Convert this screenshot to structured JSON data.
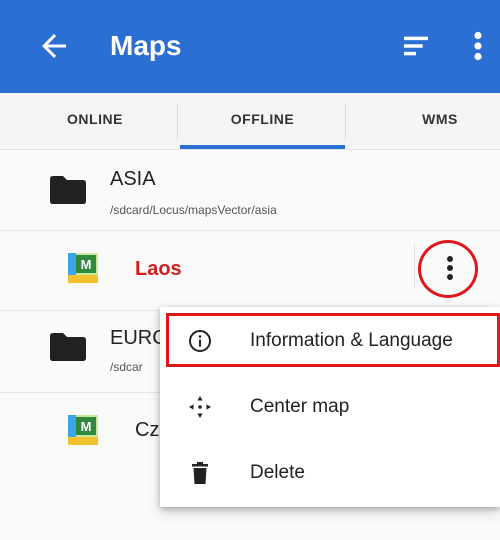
{
  "appbar": {
    "title": "Maps"
  },
  "tabs": [
    "ONLINE",
    "OFFLINE",
    "WMS"
  ],
  "list": {
    "folder_asia": {
      "name": "ASIA",
      "path": "/sdcard/Locus/mapsVector/asia"
    },
    "map_laos": {
      "name": "Laos"
    },
    "folder_europe": {
      "name": "EURC",
      "path": "/sdcar"
    },
    "map_czech": {
      "name": "Cz"
    }
  },
  "menu": {
    "items": [
      "Information & Language",
      "Center map",
      "Delete"
    ]
  },
  "colors": {
    "appbar": "#2b6fd2",
    "highlight": "#e0161b",
    "active_map": "#d01f1f"
  }
}
